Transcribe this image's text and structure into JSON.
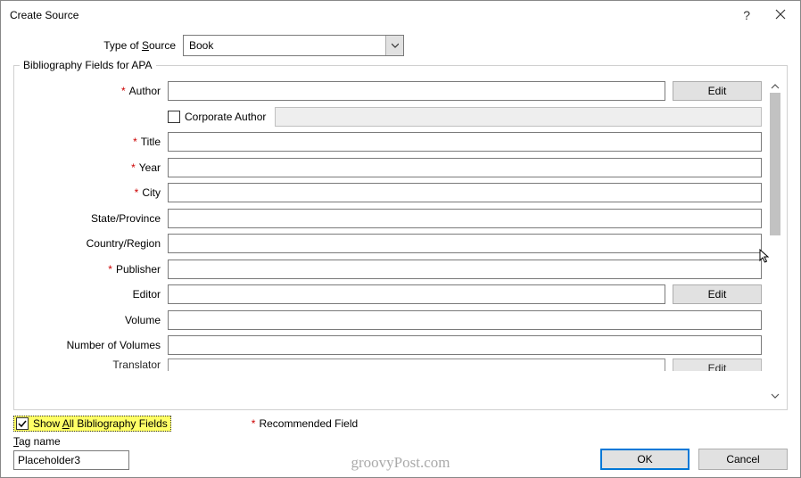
{
  "title": "Create Source",
  "source_type": {
    "label_pre": "Type of ",
    "label_ul": "S",
    "label_post": "ource",
    "value": "Book"
  },
  "fieldset_legend": "Bibliography Fields for APA",
  "fields": [
    {
      "label": "Author",
      "required": true,
      "edit": true
    },
    {
      "corporate": true,
      "label": "Corporate Author"
    },
    {
      "label": "Title",
      "required": true
    },
    {
      "label": "Year",
      "required": true
    },
    {
      "label": "City",
      "required": true
    },
    {
      "label": "State/Province",
      "required": false
    },
    {
      "label": "Country/Region",
      "required": false
    },
    {
      "label": "Publisher",
      "required": true
    },
    {
      "label": "Editor",
      "required": false,
      "edit": true
    },
    {
      "label": "Volume",
      "required": false
    },
    {
      "label": "Number of Volumes",
      "required": false
    },
    {
      "label": "Translator",
      "required": false,
      "edit": true,
      "partial": true
    }
  ],
  "edit_label": "Edit",
  "show_all": {
    "pre": "Show ",
    "ul": "A",
    "post": "ll Bibliography Fields",
    "checked": true
  },
  "recommended": "Recommended Field",
  "tag": {
    "label_ul": "T",
    "label_post": "ag name",
    "value": "Placeholder3"
  },
  "buttons": {
    "ok": "OK",
    "cancel": "Cancel"
  },
  "watermark": "groovyPost.com"
}
